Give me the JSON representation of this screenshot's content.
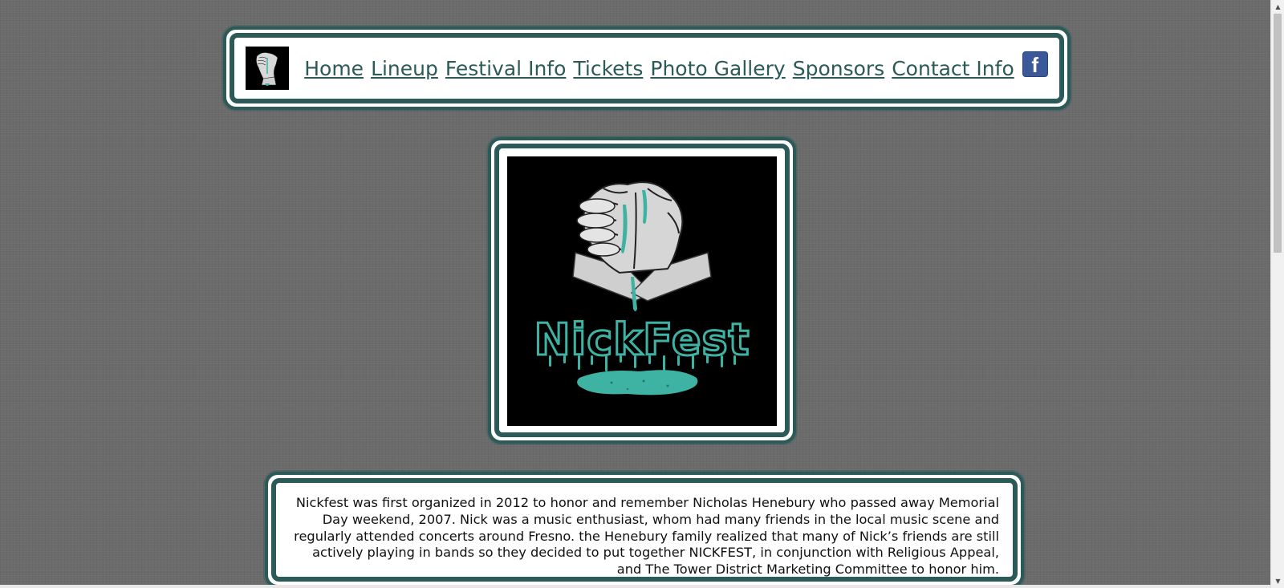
{
  "nav": {
    "logo_icon": "nickfest-handshake-logo",
    "links": [
      {
        "label": "Home"
      },
      {
        "label": "Lineup"
      },
      {
        "label": "Festival Info"
      },
      {
        "label": "Tickets"
      },
      {
        "label": "Photo Gallery"
      },
      {
        "label": "Sponsors"
      },
      {
        "label": "Contact Info"
      }
    ],
    "facebook_icon": "facebook-icon",
    "facebook_glyph": "f"
  },
  "hero_logo": {
    "icon": "nickfest-handshake-dripping-logo",
    "wordmark": "NickFest"
  },
  "intro": {
    "text": "Nickfest was first organized in 2012 to honor and remember Nicholas Henebury who passed away Memorial Day weekend, 2007. Nick was a music enthusiast, whom had many friends in the local music scene and regularly attended concerts around Fresno. the Henebury family realized that many of Nick’s friends are still actively playing in bands so they decided to put together NICKFEST, in conjunction with Religious Appeal, and The Tower District Marketing Committee to honor him."
  },
  "colors": {
    "frame_teal": "#2b5a58",
    "link_teal": "#2b5a58",
    "drip_teal": "#3fb3a3",
    "background_gray": "#6b6b6b",
    "facebook_blue": "#3b5998"
  }
}
